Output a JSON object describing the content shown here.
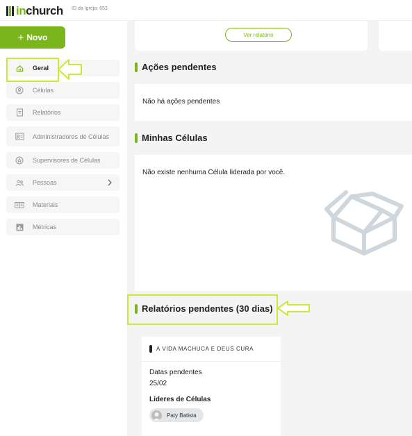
{
  "app": {
    "logo_prefix": "in",
    "logo_suffix": "church",
    "church_id": "ID da Igreja: 653"
  },
  "sidebar": {
    "new_button_label": "Novo",
    "items": [
      {
        "label": "Geral",
        "icon": "home-icon"
      },
      {
        "label": "Células",
        "icon": "location-pin-icon"
      },
      {
        "label": "Relatórios",
        "icon": "document-icon"
      },
      {
        "label": "Administradores de Células",
        "icon": "id-card-icon"
      },
      {
        "label": "Supervisores de Células",
        "icon": "star-badge-icon"
      },
      {
        "label": "Pessoas",
        "icon": "people-icon"
      },
      {
        "label": "Materiais",
        "icon": "book-icon"
      },
      {
        "label": "Métricas",
        "icon": "bar-chart-icon"
      }
    ]
  },
  "main": {
    "ver_relatorio_label": "Ver relatório",
    "acoes": {
      "title": "Ações pendentes",
      "empty": "Não há ações pendentes"
    },
    "minhas": {
      "title": "Minhas Células",
      "empty": "Não existe nenhuma Célula liderada por você."
    },
    "relatorios": {
      "title": "Relatórios pendentes (30 dias)",
      "card": {
        "cell_name": "A VIDA MACHUCA E DEUS CURA",
        "dates_label": "Datas pendentes",
        "date": "25/02",
        "leaders_label": "Líderes de Células",
        "leader": "Paty Batista"
      }
    }
  },
  "colors": {
    "brand_green": "#7ab51d",
    "highlight": "#c7ea3b"
  }
}
